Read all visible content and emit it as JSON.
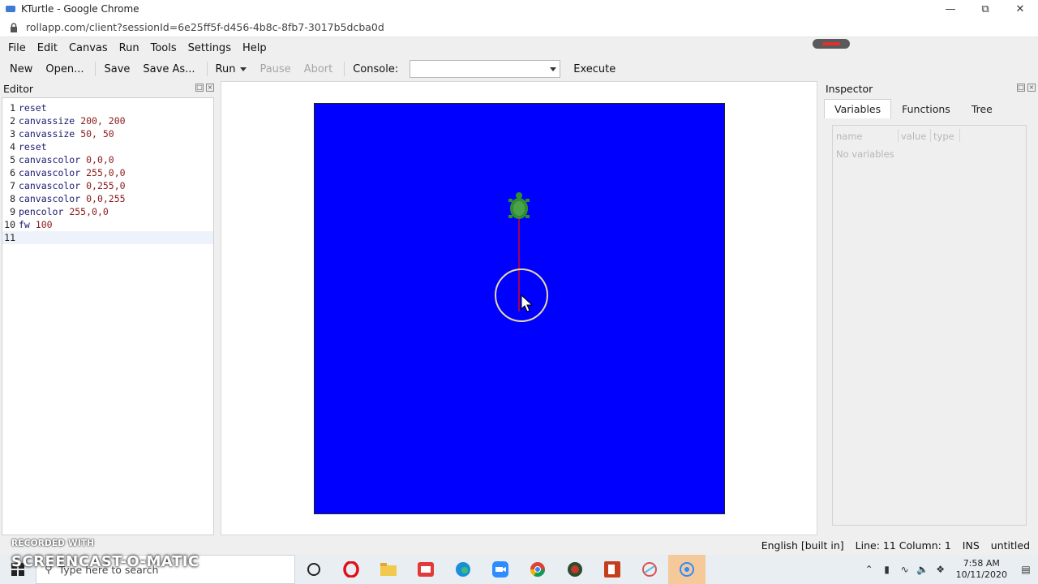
{
  "browser": {
    "window_title": "KTurtle - Google Chrome",
    "url": "rollapp.com/client?sessionId=6e25ff5f-d456-4b8c-8fb7-3017b5dcba0d"
  },
  "menubar": {
    "items": [
      {
        "label": "File"
      },
      {
        "label": "Edit"
      },
      {
        "label": "Canvas"
      },
      {
        "label": "Run"
      },
      {
        "label": "Tools"
      },
      {
        "label": "Settings"
      },
      {
        "label": "Help"
      }
    ]
  },
  "toolbar": {
    "new_label": "New",
    "open_label": "Open...",
    "save_label": "Save",
    "save_as_label": "Save As...",
    "run_label": "Run",
    "pause_label": "Pause",
    "abort_label": "Abort",
    "console_label": "Console:",
    "console_value": "",
    "execute_label": "Execute"
  },
  "editor": {
    "title": "Editor",
    "lines": [
      {
        "n": "1",
        "cmd": "reset",
        "args": ""
      },
      {
        "n": "2",
        "cmd": "canvassize",
        "args": "200, 200"
      },
      {
        "n": "3",
        "cmd": "canvassize",
        "args": "50, 50"
      },
      {
        "n": "4",
        "cmd": "reset",
        "args": ""
      },
      {
        "n": "5",
        "cmd": "canvascolor",
        "args": "0,0,0"
      },
      {
        "n": "6",
        "cmd": "canvascolor",
        "args": "255,0,0"
      },
      {
        "n": "7",
        "cmd": "canvascolor",
        "args": "0,255,0"
      },
      {
        "n": "8",
        "cmd": "canvascolor",
        "args": "0,0,255"
      },
      {
        "n": "9",
        "cmd": "pencolor",
        "args": "255,0,0"
      },
      {
        "n": "10",
        "cmd": "fw",
        "args": "100"
      },
      {
        "n": "11",
        "cmd": "",
        "args": ""
      }
    ]
  },
  "canvas": {
    "background_color": "#0000ff",
    "pen_color": "#ff0000",
    "turtle_color": "#2f8f2f"
  },
  "inspector": {
    "title": "Inspector",
    "tabs": [
      {
        "label": "Variables",
        "active": true
      },
      {
        "label": "Functions",
        "active": false
      },
      {
        "label": "Tree",
        "active": false
      }
    ],
    "columns": [
      "name",
      "value",
      "type"
    ],
    "empty_text": "No variables"
  },
  "statusbar": {
    "language": "English [built in]",
    "position": "Line: 11 Column: 1",
    "mode": "INS",
    "document": "untitled"
  },
  "recorder": {
    "badge": "RECORDED WITH",
    "brand": "SCREENCAST-O-MATIC"
  },
  "taskbar": {
    "search_placeholder": "Type here to search",
    "clock_time": "7:58 AM",
    "clock_date": "10/11/2020"
  }
}
